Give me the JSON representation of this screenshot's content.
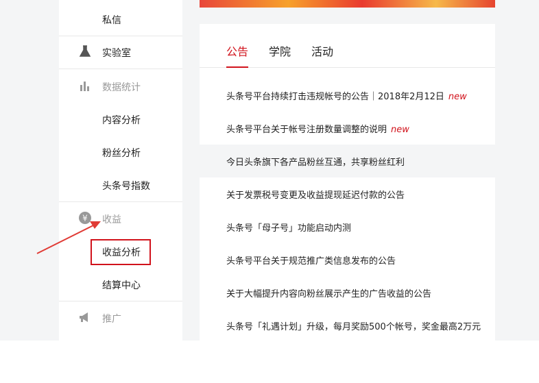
{
  "sidebar": {
    "items": [
      {
        "label": "私信",
        "icon": "none",
        "section": false
      },
      {
        "label": "实验室",
        "icon": "flask-icon",
        "section": false
      },
      {
        "label": "数据统计",
        "icon": "bar-chart-icon",
        "section": true
      },
      {
        "label": "内容分析",
        "icon": "none",
        "section": false
      },
      {
        "label": "粉丝分析",
        "icon": "none",
        "section": false
      },
      {
        "label": "头条号指数",
        "icon": "none",
        "section": false
      },
      {
        "label": "收益",
        "icon": "yen-coin-icon",
        "section": true
      },
      {
        "label": "收益分析",
        "icon": "none",
        "section": false
      },
      {
        "label": "结算中心",
        "icon": "none",
        "section": false
      },
      {
        "label": "推广",
        "icon": "megaphone-icon",
        "section": true
      }
    ]
  },
  "tabs": [
    {
      "label": "公告",
      "active": true
    },
    {
      "label": "学院",
      "active": false
    },
    {
      "label": "活动",
      "active": false
    }
  ],
  "notices": [
    {
      "text": "头条号平台持续打击违规帐号的公告｜2018年2月12日",
      "new": "new"
    },
    {
      "text": "头条号平台关于帐号注册数量调整的说明",
      "new": "new"
    },
    {
      "text": "今日头条旗下各产品粉丝互通，共享粉丝红利",
      "new": ""
    },
    {
      "text": "关于发票税号变更及收益提现延迟付款的公告",
      "new": ""
    },
    {
      "text": "头条号「母子号」功能启动内测",
      "new": ""
    },
    {
      "text": "头条号平台关于规范推广类信息发布的公告",
      "new": ""
    },
    {
      "text": "关于大幅提升内容向粉丝展示产生的广告收益的公告",
      "new": ""
    },
    {
      "text": "头条号「礼遇计划」升级，每月奖励500个帐号，奖金最高2万元",
      "new": ""
    }
  ],
  "colors": {
    "accent": "#d1121b",
    "page_bg": "#f4f5f6"
  }
}
